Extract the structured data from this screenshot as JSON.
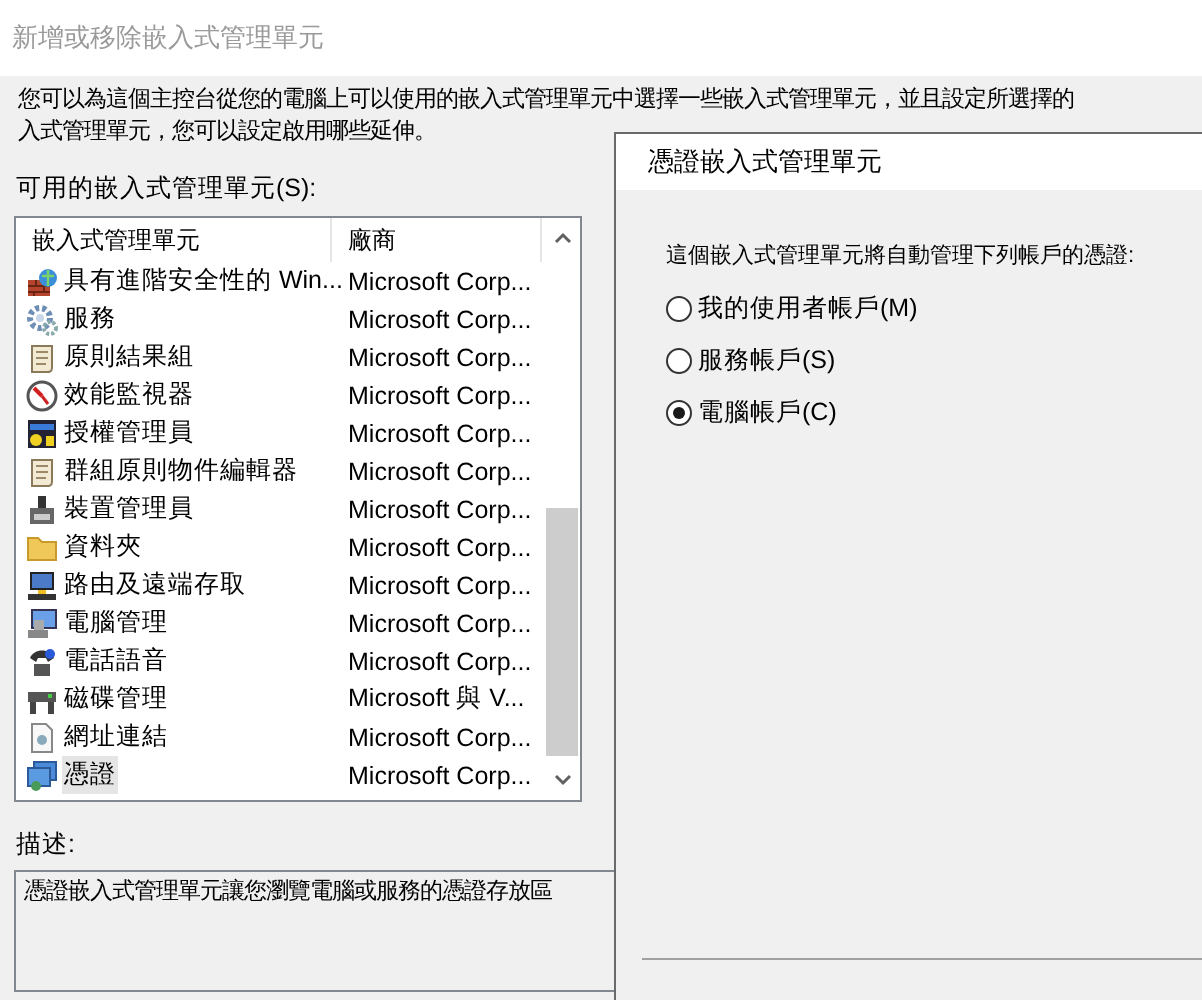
{
  "window": {
    "title": "新增或移除嵌入式管理單元"
  },
  "intro_lines": [
    "您可以為這個主控台從您的電腦上可以使用的嵌入式管理單元中選擇一些嵌入式管理單元，並且設定所選擇的",
    "入式管理單元，您可以設定啟用哪些延伸。"
  ],
  "available_label": "可用的嵌入式管理單元(S):",
  "snapin_list": {
    "columns": [
      "嵌入式管理單元",
      "廠商"
    ],
    "rows": [
      {
        "name": "具有進階安全性的 Win...",
        "vendor": "Microsoft Corp...",
        "selected": false
      },
      {
        "name": "服務",
        "vendor": "Microsoft Corp...",
        "selected": false
      },
      {
        "name": "原則結果組",
        "vendor": "Microsoft Corp...",
        "selected": false
      },
      {
        "name": "效能監視器",
        "vendor": "Microsoft Corp...",
        "selected": false
      },
      {
        "name": "授權管理員",
        "vendor": "Microsoft Corp...",
        "selected": false
      },
      {
        "name": "群組原則物件編輯器",
        "vendor": "Microsoft Corp...",
        "selected": false
      },
      {
        "name": "裝置管理員",
        "vendor": "Microsoft Corp...",
        "selected": false
      },
      {
        "name": "資料夾",
        "vendor": "Microsoft Corp...",
        "selected": false
      },
      {
        "name": "路由及遠端存取",
        "vendor": "Microsoft Corp...",
        "selected": false
      },
      {
        "name": "電腦管理",
        "vendor": "Microsoft Corp...",
        "selected": false
      },
      {
        "name": "電話語音",
        "vendor": "Microsoft Corp...",
        "selected": false
      },
      {
        "name": "磁碟管理",
        "vendor": "Microsoft 與 V...",
        "selected": false
      },
      {
        "name": "網址連結",
        "vendor": "Microsoft Corp...",
        "selected": false
      },
      {
        "name": "憑證",
        "vendor": "Microsoft Corp...",
        "selected": true
      }
    ]
  },
  "description": {
    "label": "描述:",
    "text": "憑證嵌入式管理單元讓您瀏覽電腦或服務的憑證存放區"
  },
  "cert_dialog": {
    "title": "憑證嵌入式管理單元",
    "prompt": "這個嵌入式管理單元將自動管理下列帳戶的憑證:",
    "options": [
      {
        "label": "我的使用者帳戶(M)",
        "selected": false
      },
      {
        "label": "服務帳戶(S)",
        "selected": false
      },
      {
        "label": "電腦帳戶(C)",
        "selected": true
      }
    ]
  }
}
